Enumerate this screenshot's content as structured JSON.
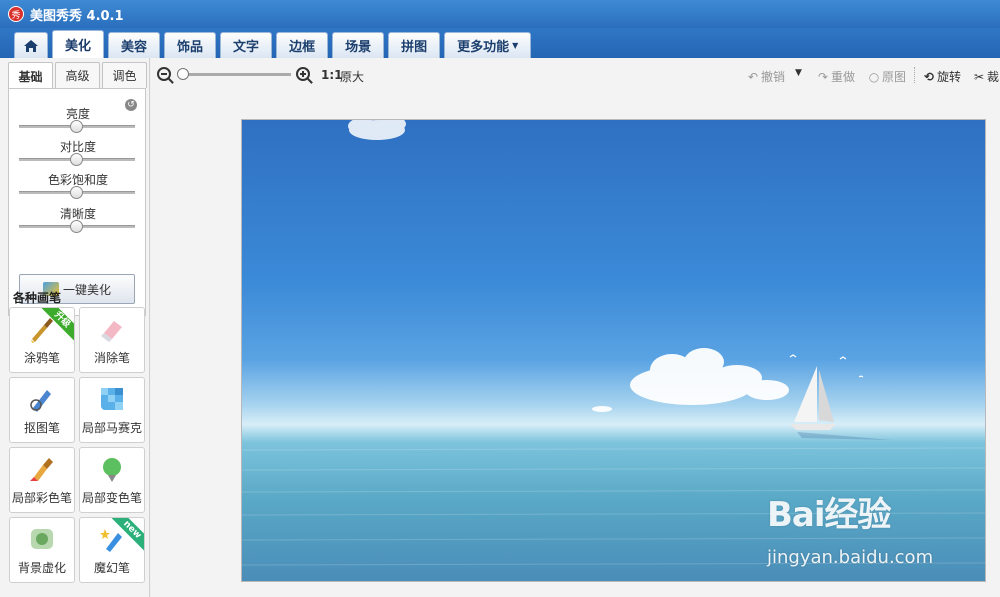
{
  "app": {
    "title": "美图秀秀 4.0.1",
    "logo_char": "秀"
  },
  "tabs": [
    {
      "label": "美化",
      "active": true
    },
    {
      "label": "美容"
    },
    {
      "label": "饰品"
    },
    {
      "label": "文字"
    },
    {
      "label": "边框"
    },
    {
      "label": "场景"
    },
    {
      "label": "拼图"
    },
    {
      "label": "更多功能"
    }
  ],
  "subtabs": [
    {
      "label": "基础",
      "active": true
    },
    {
      "label": "高级"
    },
    {
      "label": "调色"
    }
  ],
  "adjustments": {
    "sliders": [
      {
        "label": "亮度",
        "value": 0.5
      },
      {
        "label": "对比度",
        "value": 0.5
      },
      {
        "label": "色彩饱和度",
        "value": 0.5
      },
      {
        "label": "清晰度",
        "value": 0.5
      }
    ],
    "one_key_label": "一键美化"
  },
  "brushes": {
    "title": "各种画笔",
    "items": [
      {
        "label": "涂鸦笔",
        "badge": "升级"
      },
      {
        "label": "消除笔"
      },
      {
        "label": "抠图笔"
      },
      {
        "label": "局部马赛克"
      },
      {
        "label": "局部彩色笔"
      },
      {
        "label": "局部变色笔"
      },
      {
        "label": "背景虚化"
      },
      {
        "label": "魔幻笔",
        "badge": "new"
      }
    ]
  },
  "toolbar": {
    "ratio": "1:1",
    "original_size": "原大",
    "undo": "撤销",
    "redo": "重做",
    "original": "原图",
    "rotate": "旋转",
    "crop": "裁"
  },
  "watermark": {
    "logo": "Bai经验",
    "url": "jingyan.baidu.com"
  },
  "colors": {
    "titlebar": "#2a6fbd",
    "sky": "#3b8ad8",
    "sea": "#5aa9c7"
  }
}
